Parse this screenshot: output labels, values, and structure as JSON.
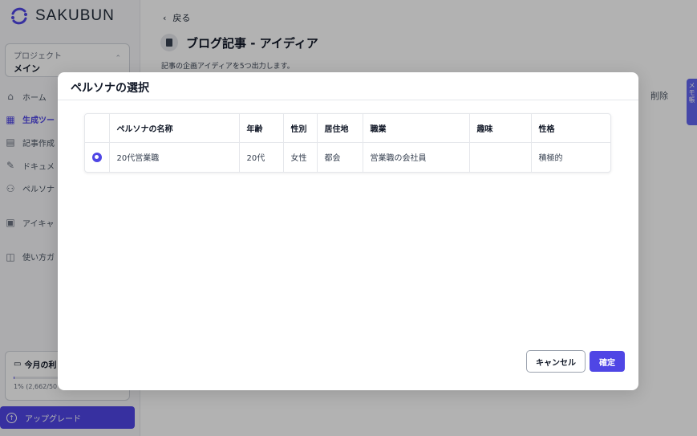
{
  "app": {
    "brand": "SAKUBUN"
  },
  "project": {
    "label": "プロジェクト",
    "name": "メイン"
  },
  "nav": {
    "items": [
      {
        "label": "ホーム",
        "icon": "home-icon"
      },
      {
        "label": "生成ツー",
        "icon": "grid-icon",
        "active": true
      },
      {
        "label": "記事作成",
        "icon": "article-icon"
      },
      {
        "label": "ドキュメ",
        "icon": "edit-icon"
      },
      {
        "label": "ペルソナ",
        "icon": "persona-icon"
      },
      {
        "label": "アイキャ",
        "icon": "image-icon"
      },
      {
        "label": "使い方ガ",
        "icon": "book-icon"
      }
    ]
  },
  "usage": {
    "title": "今月の利",
    "text": "1% (2,662/50",
    "percent": 1
  },
  "upgrade": {
    "label": "アップグレード"
  },
  "main": {
    "back_label": "戻る",
    "title": "ブログ記事 - アイディア",
    "description": "記事の企画アイディアを5つ出力します。",
    "delete_label": "削除",
    "memo_label": "メモ帳"
  },
  "modal": {
    "title": "ペルソナの選択",
    "columns": [
      "ペルソナの名称",
      "年齢",
      "性別",
      "居住地",
      "職業",
      "趣味",
      "性格"
    ],
    "rows": [
      {
        "selected": true,
        "cells": [
          "20代営業職",
          "20代",
          "女性",
          "都会",
          "営業職の会社員",
          "",
          "積極的"
        ]
      }
    ],
    "cancel_label": "キャンセル",
    "confirm_label": "確定"
  },
  "colors": {
    "accent": "#4f46e5"
  }
}
